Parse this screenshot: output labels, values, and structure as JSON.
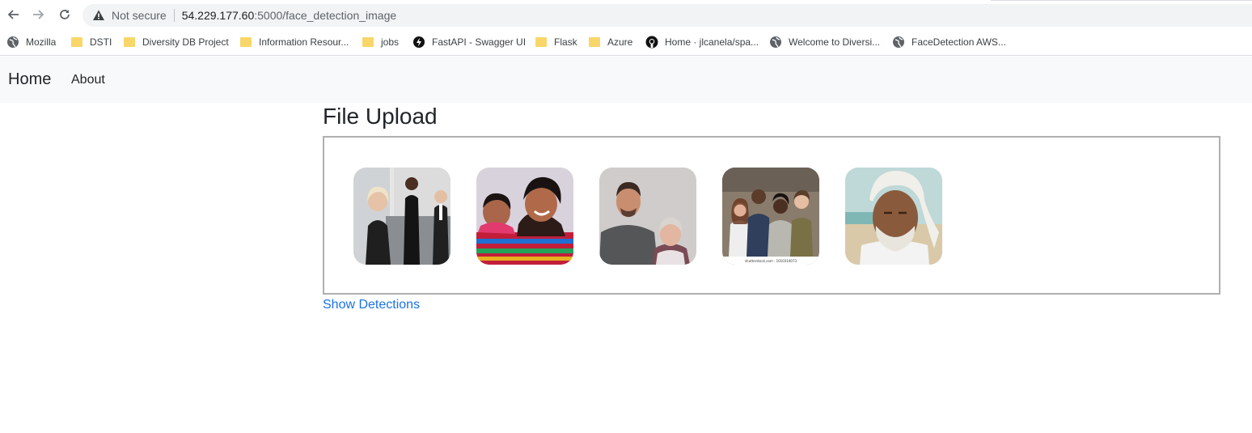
{
  "browser": {
    "back_icon": "arrow-left-icon",
    "forward_icon": "arrow-right-icon",
    "reload_icon": "reload-icon",
    "security_label": "Not secure",
    "url_host": "54.229.177.60",
    "url_rest": ":5000/face_detection_image",
    "bookmarks": [
      {
        "label": "Mozilla",
        "icon": "globe-icon"
      },
      {
        "label": "DSTI",
        "icon": "folder-icon"
      },
      {
        "label": "Diversity DB Project",
        "icon": "folder-icon"
      },
      {
        "label": "Information Resour...",
        "icon": "folder-icon"
      },
      {
        "label": "jobs",
        "icon": "folder-icon"
      },
      {
        "label": "FastAPI - Swagger UI",
        "icon": "fastapi-icon"
      },
      {
        "label": "Flask",
        "icon": "folder-icon"
      },
      {
        "label": "Azure",
        "icon": "folder-icon"
      },
      {
        "label": "Home · jlcanela/spa...",
        "icon": "github-icon"
      },
      {
        "label": "Welcome to Diversi...",
        "icon": "globe-icon"
      },
      {
        "label": "FaceDetection AWS...",
        "icon": "globe-icon"
      }
    ]
  },
  "navbar": {
    "brand": "Home",
    "links": [
      "About"
    ],
    "background": "#f8f9fa"
  },
  "main": {
    "title": "File Upload",
    "images": [
      {
        "name": "business-people-photo"
      },
      {
        "name": "mother-and-child-photo"
      },
      {
        "name": "two-people-portrait-photo"
      },
      {
        "name": "group-of-friends-photo",
        "caption": "shutterstock.com · 1010314073"
      },
      {
        "name": "elderly-man-turban-photo"
      }
    ],
    "show_detections_label": "Show Detections",
    "link_color": "#1a73e8"
  }
}
